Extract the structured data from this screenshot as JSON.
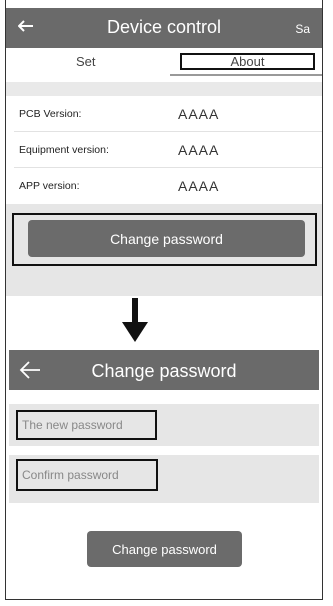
{
  "top_screen": {
    "header": {
      "title": "Device control",
      "right_text": "Sa"
    },
    "tabs": [
      {
        "label": "Set"
      },
      {
        "label": "About"
      }
    ],
    "info": [
      {
        "label": "PCB Version:",
        "value": "AAAA"
      },
      {
        "label": "Equipment version:",
        "value": "AAAA"
      },
      {
        "label": "APP version:",
        "value": "AAAA"
      }
    ],
    "change_password_button": "Change password"
  },
  "bottom_screen": {
    "header": {
      "title": "Change password"
    },
    "new_password": {
      "placeholder": "The new password"
    },
    "confirm_password": {
      "placeholder": "Confirm password"
    },
    "change_password_button": "Change password"
  },
  "colors": {
    "header_bg": "#6a6a6a",
    "button_bg": "#6b6b6b",
    "panel_bg": "#e6e6e6"
  }
}
